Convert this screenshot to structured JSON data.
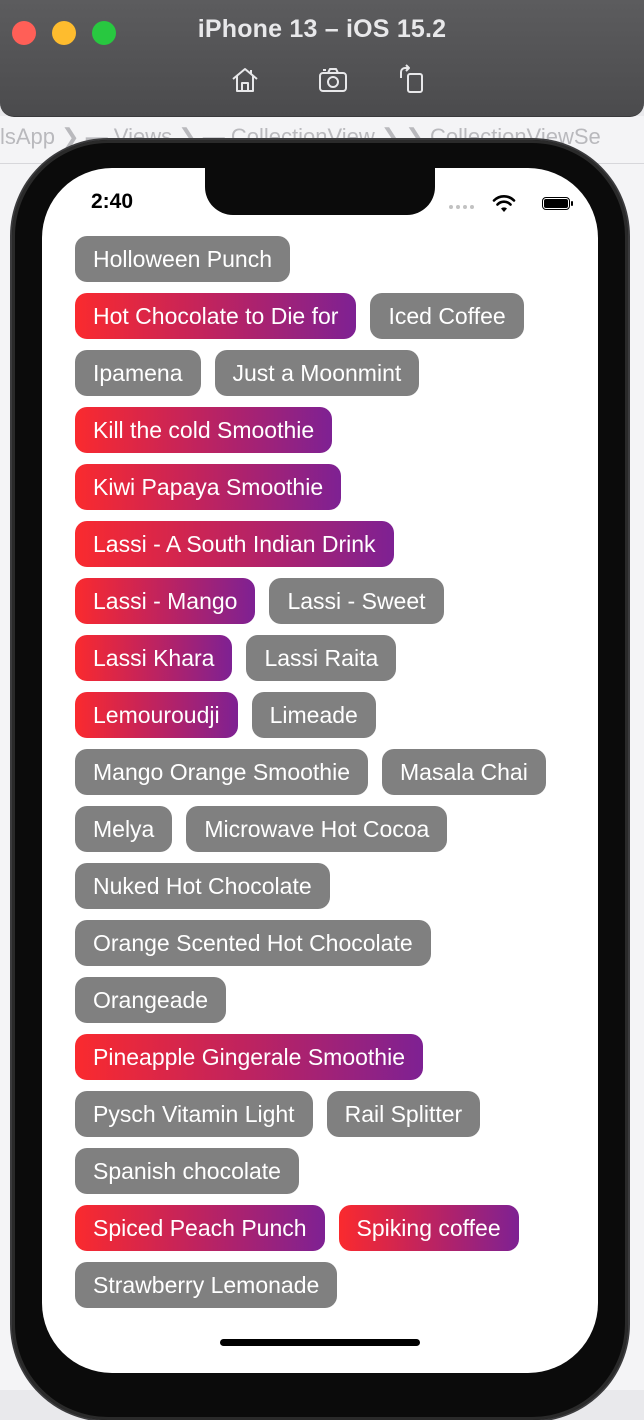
{
  "simulator": {
    "title": "iPhone 13 – iOS 15.2",
    "toolbar": [
      {
        "icon": "home-icon"
      },
      {
        "icon": "screenshot-camera-icon"
      },
      {
        "icon": "rotate-icon"
      }
    ]
  },
  "background": {
    "breadcrumb": "lsApp ❯ ▬ Views ❯ ▬ CollectionView ❯ ❯ CollectionViewSe"
  },
  "status_bar": {
    "time": "2:40"
  },
  "tag_rows": [
    [
      {
        "label": "Holloween Punch",
        "style": "gray"
      }
    ],
    [
      {
        "label": "Hot Chocolate to Die for",
        "style": "grad"
      },
      {
        "label": "Iced Coffee",
        "style": "gray"
      }
    ],
    [
      {
        "label": "Ipamena",
        "style": "gray"
      },
      {
        "label": "Just a Moonmint",
        "style": "gray"
      }
    ],
    [
      {
        "label": "Kill the cold Smoothie",
        "style": "grad"
      }
    ],
    [
      {
        "label": "Kiwi Papaya Smoothie",
        "style": "grad"
      }
    ],
    [
      {
        "label": "Lassi - A South Indian Drink",
        "style": "grad"
      }
    ],
    [
      {
        "label": "Lassi - Mango",
        "style": "grad"
      },
      {
        "label": "Lassi - Sweet",
        "style": "gray"
      }
    ],
    [
      {
        "label": "Lassi Khara",
        "style": "grad"
      },
      {
        "label": "Lassi Raita",
        "style": "gray"
      }
    ],
    [
      {
        "label": "Lemouroudji",
        "style": "grad"
      },
      {
        "label": "Limeade",
        "style": "gray"
      }
    ],
    [
      {
        "label": "Mango Orange Smoothie",
        "style": "gray"
      },
      {
        "label": "Masala Chai",
        "style": "gray"
      }
    ],
    [
      {
        "label": "Melya",
        "style": "gray"
      },
      {
        "label": "Microwave Hot Cocoa",
        "style": "gray"
      }
    ],
    [
      {
        "label": "Nuked Hot Chocolate",
        "style": "gray"
      }
    ],
    [
      {
        "label": "Orange Scented Hot Chocolate",
        "style": "gray"
      }
    ],
    [
      {
        "label": "Orangeade",
        "style": "gray"
      }
    ],
    [
      {
        "label": "Pineapple Gingerale Smoothie",
        "style": "grad"
      }
    ],
    [
      {
        "label": "Pysch Vitamin Light",
        "style": "gray"
      },
      {
        "label": "Rail Splitter",
        "style": "gray"
      }
    ],
    [
      {
        "label": "Spanish chocolate",
        "style": "gray"
      }
    ],
    [
      {
        "label": "Spiced Peach Punch",
        "style": "grad"
      },
      {
        "label": "Spiking coffee",
        "style": "grad"
      }
    ],
    [
      {
        "label": "Strawberry Lemonade",
        "style": "gray"
      }
    ]
  ],
  "colors": {
    "tag_gray": "#808080",
    "gradient_start": "#fa2a2e",
    "gradient_end": "#7e2193"
  }
}
